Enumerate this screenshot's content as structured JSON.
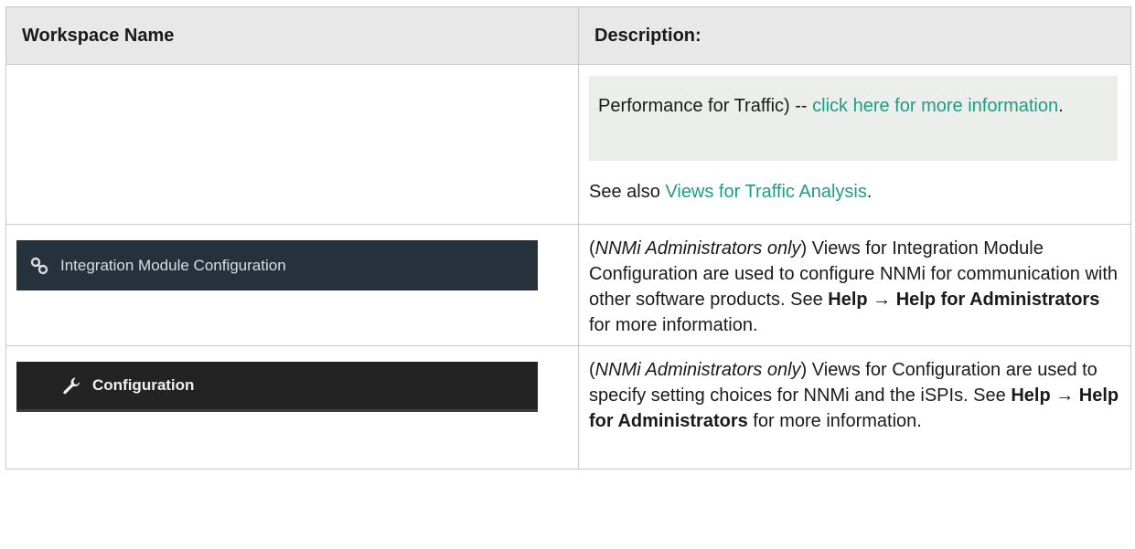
{
  "header": {
    "col_name": "Workspace Name",
    "col_desc": "Description:"
  },
  "rows": [
    {
      "note_text": "Performance for Traffic) -- ",
      "note_link": "click here for more information",
      "note_end": ".",
      "also_prefix": "See also ",
      "also_link": "Views for Traffic Analysis",
      "also_end": "."
    },
    {
      "banner_label": "Integration Module Configuration",
      "banner_icon": "link-icon",
      "desc_role": "NNMi Administrators only",
      "desc_text": "Views for Integration Module Configuration are used to configure NNMi for communication with other software products. See",
      "menu_path": "Help → Help for Administrators",
      "desc_tail": "for more information."
    },
    {
      "banner_label": "Configuration",
      "banner_icon": "wrench-icon",
      "desc_role": "NNMi Administrators only",
      "desc_text": "Views for Configuration are used to specify setting choices for NNMi and the iSPIs. See",
      "menu_path": "Help → Help for Administrators",
      "desc_tail": "for more information."
    }
  ],
  "colors": {
    "link": "#1a9e86",
    "header_bg": "#e8e8e8",
    "banner_integration_bg": "#26313c",
    "banner_configuration_bg": "#232323"
  }
}
